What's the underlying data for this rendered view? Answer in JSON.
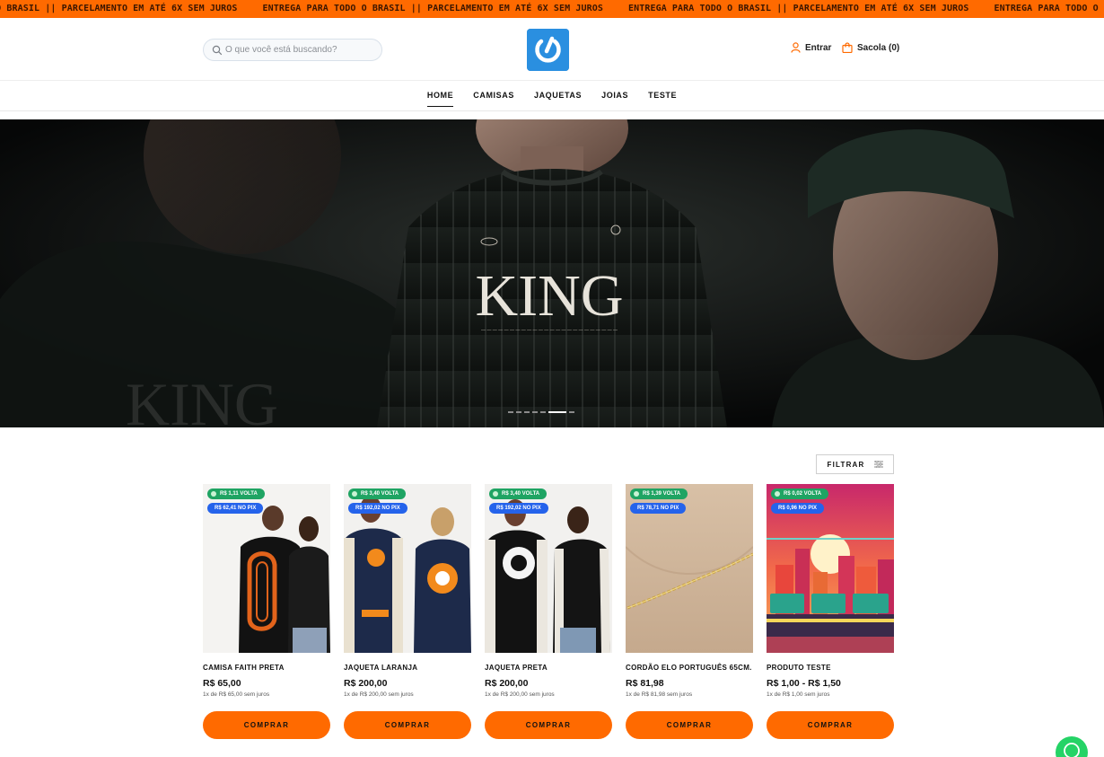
{
  "topbar": {
    "message": "ENTREGA PARA TODO O BRASIL || PARCELAMENTO EM ATÉ 6X SEM JUROS"
  },
  "header": {
    "search_placeholder": "O que você está buscando?",
    "account_label": "Entrar",
    "cart_label": "Sacola (0)"
  },
  "nav": {
    "items": [
      "HOME",
      "CAMISAS",
      "JAQUETAS",
      "JOIAS",
      "TESTE"
    ],
    "active": "HOME"
  },
  "banner": {
    "headline": "KING",
    "slides_total": 7,
    "active_slide": 6
  },
  "filter": {
    "label": "FILTRAR"
  },
  "products": [
    {
      "name": "CAMISA FAITH PRETA",
      "price": "R$ 65,00",
      "installments": "1x de R$ 65,00 sem juros",
      "cashback": "R$ 1,11 VOLTA",
      "pix": "R$ 62,41 NO PIX",
      "button": "COMPRAR"
    },
    {
      "name": "JAQUETA LARANJA",
      "price": "R$ 200,00",
      "installments": "1x de R$ 200,00 sem juros",
      "cashback": "R$ 3,40 VOLTA",
      "pix": "R$ 192,02 NO PIX",
      "button": "COMPRAR"
    },
    {
      "name": "JAQUETA PRETA",
      "price": "R$ 200,00",
      "installments": "1x de R$ 200,00 sem juros",
      "cashback": "R$ 3,40 VOLTA",
      "pix": "R$ 192,02 NO PIX",
      "button": "COMPRAR"
    },
    {
      "name": "CORDÃO ELO PORTUGUÊS 65CM.",
      "price": "R$ 81,98",
      "installments": "1x de R$ 81,98 sem juros",
      "cashback": "R$ 1,39 VOLTA",
      "pix": "R$ 78,71 NO PIX",
      "button": "COMPRAR"
    },
    {
      "name": "PRODUTO TESTE",
      "price": "R$ 1,00 - R$ 1,50",
      "installments": "1x de R$ 1,00 sem juros",
      "cashback": "R$ 0,02 VOLTA",
      "pix": "R$ 0,96 NO PIX",
      "button": "COMPRAR"
    }
  ],
  "colors": {
    "accent": "#ff6a00",
    "cashback_badge": "#1fa463",
    "pix_badge": "#2563eb",
    "logo": "#2a8fe0"
  },
  "icons": {
    "search": "search-icon",
    "account": "user-icon",
    "cart": "bag-icon",
    "filter": "filter-icon",
    "whatsapp": "whatsapp-icon",
    "logo": "power-icon"
  }
}
